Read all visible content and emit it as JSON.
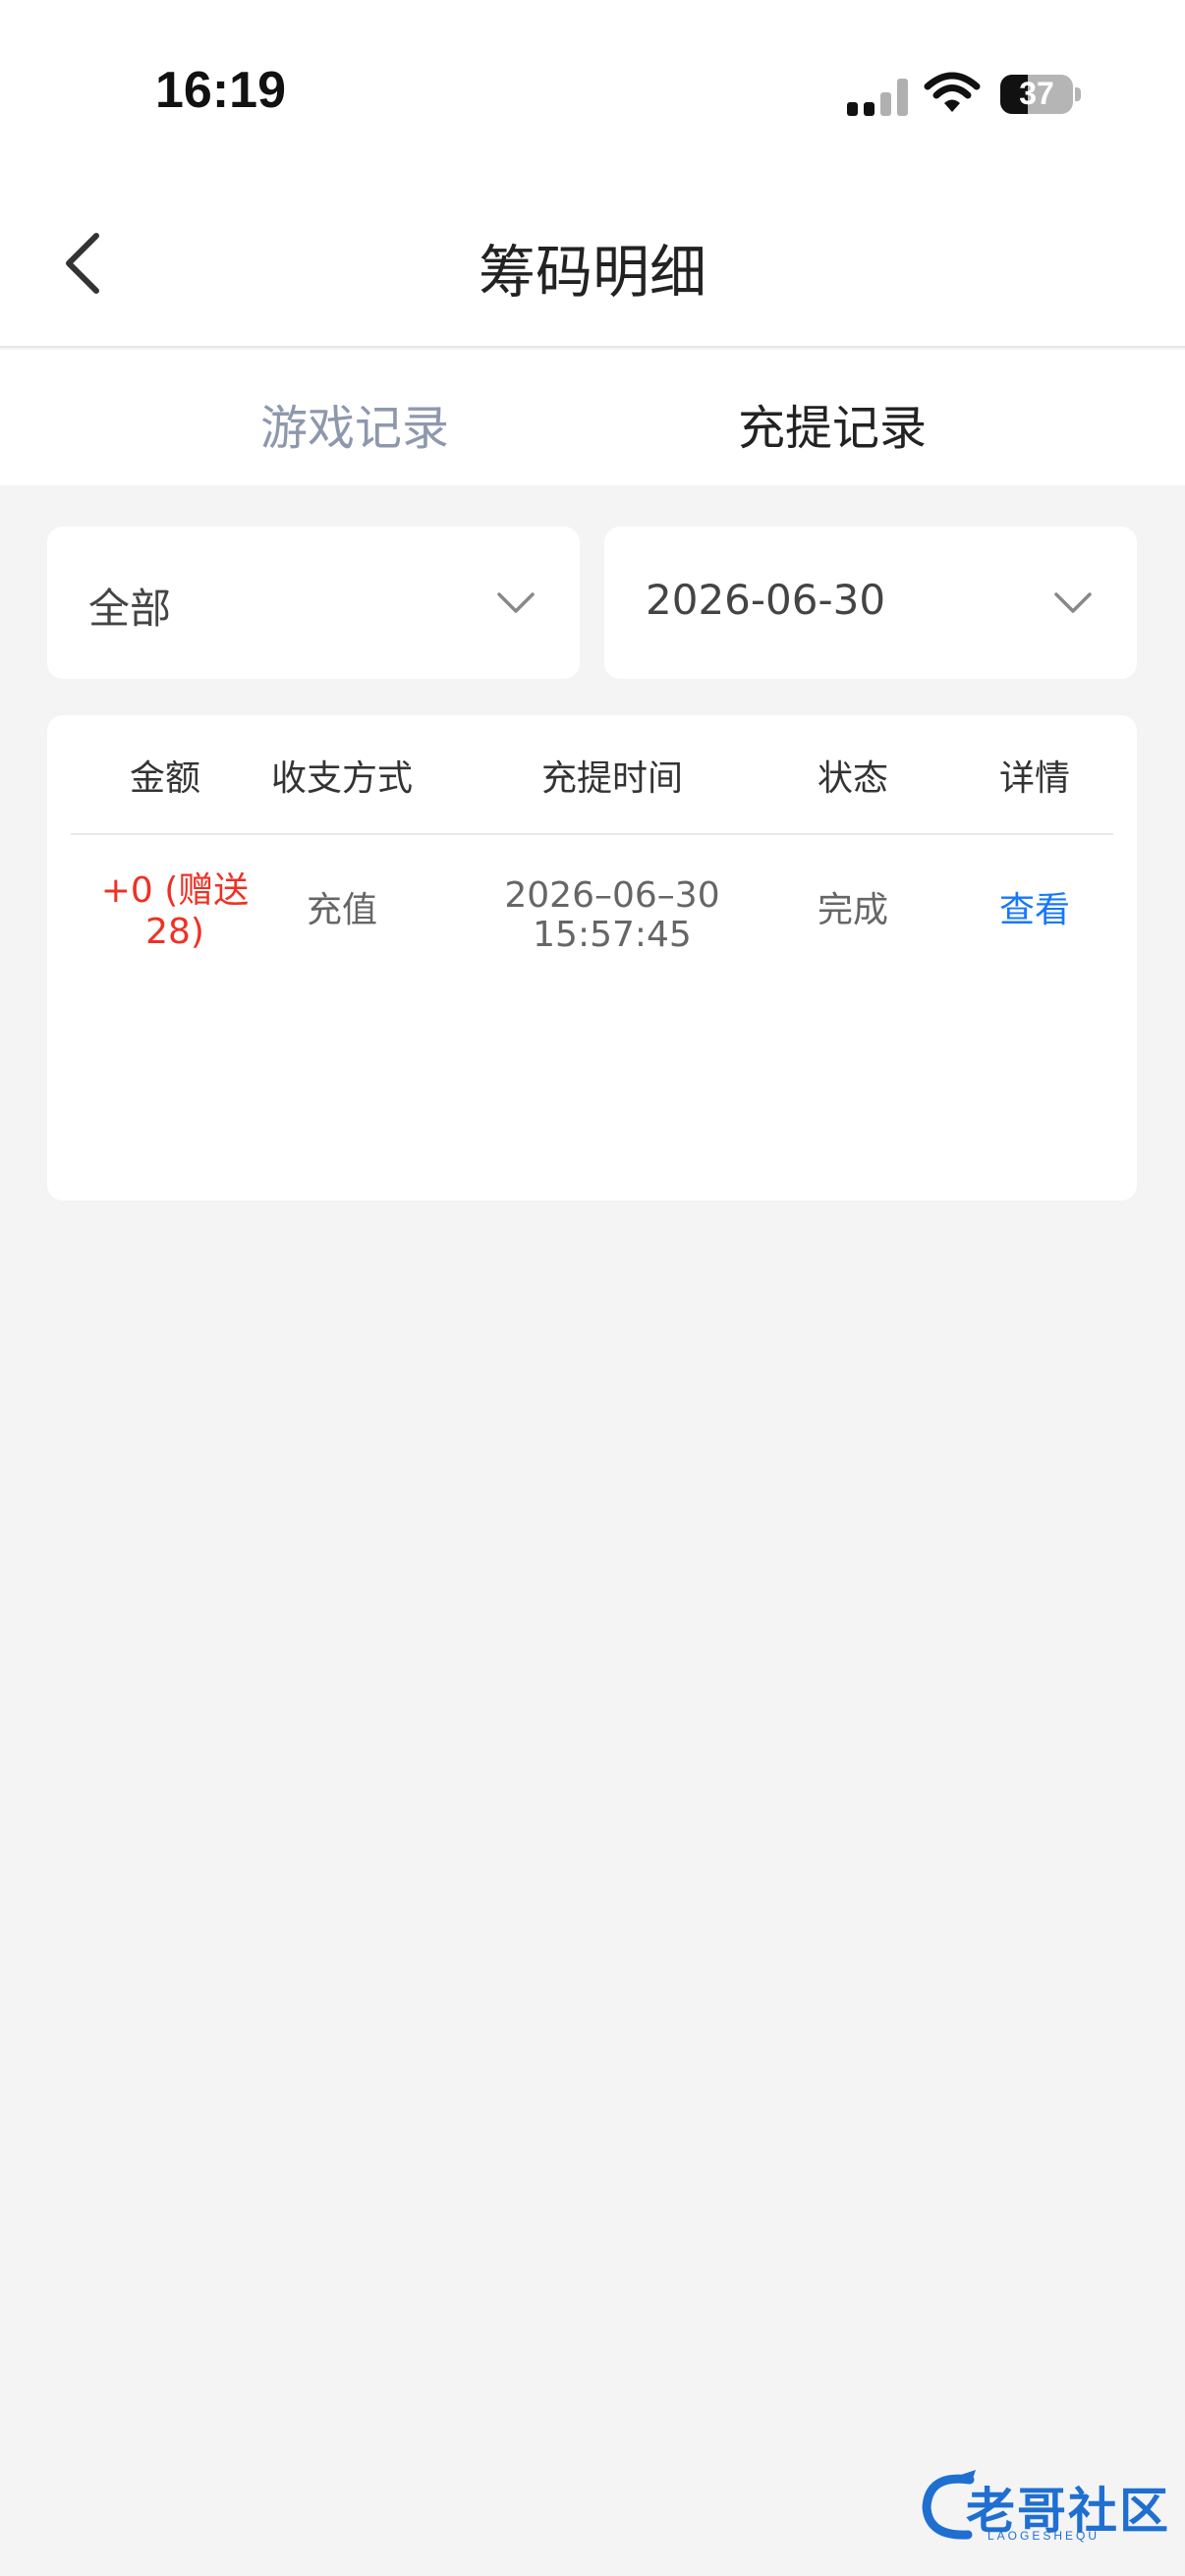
{
  "status_bar": {
    "time": "16:19",
    "battery_level": "37"
  },
  "nav": {
    "title": "筹码明细",
    "back_icon": "chevron-left-icon"
  },
  "tabs": [
    {
      "label": "游戏记录",
      "active": false
    },
    {
      "label": "充提记录",
      "active": true
    }
  ],
  "filters": {
    "type": "全部",
    "date": "2026-06-30"
  },
  "table": {
    "columns": [
      "金额",
      "收支方式",
      "充提时间",
      "状态",
      "详情"
    ],
    "rows": [
      {
        "amount_line1": "+0 (赠送",
        "amount_line2": "28)",
        "method": "充值",
        "date": "2026–06–30",
        "time": "15:57:45",
        "status": "完成",
        "detail": "查看"
      }
    ]
  },
  "watermark": {
    "text": "老哥社区",
    "sub": "LAOGESHEQU"
  },
  "colors": {
    "amount": "#ee3124",
    "link": "#1677ff",
    "inactive_tab": "#8e98ad",
    "background": "#f4f4f5"
  }
}
